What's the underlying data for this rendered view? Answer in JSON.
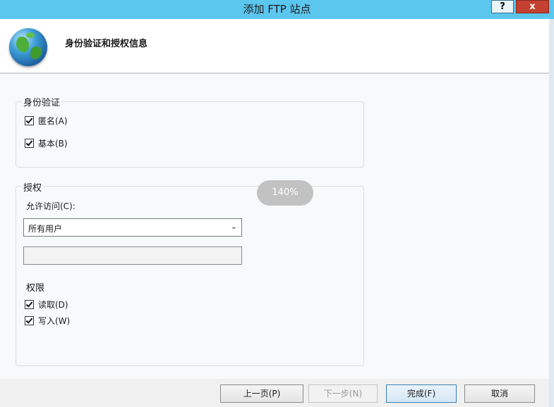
{
  "window": {
    "title": "添加 FTP 站点",
    "help_label": "?",
    "close_label": "x"
  },
  "header": {
    "icon": "globe-icon",
    "heading": "身份验证和授权信息"
  },
  "authentication": {
    "legend": "身份验证",
    "anonymous_label": "匿名(A)",
    "anonymous_checked": true,
    "basic_label": "基本(B)",
    "basic_checked": true
  },
  "authorization": {
    "legend": "授权",
    "allow_access_label": "允许访问(C):",
    "allow_access_value": "所有用户",
    "names_value": "",
    "permissions_label": "权限",
    "read_label": "读取(D)",
    "read_checked": true,
    "write_label": "写入(W)",
    "write_checked": true
  },
  "zoom_badge": "140%",
  "buttons": {
    "previous": "上一页(P)",
    "next": "下一步(N)",
    "finish": "完成(F)",
    "cancel": "取消"
  }
}
